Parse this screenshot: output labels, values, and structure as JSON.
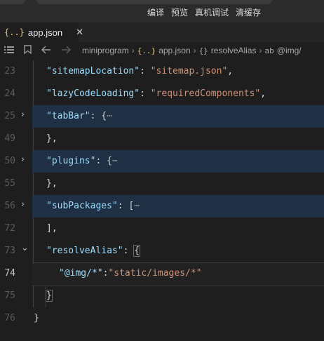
{
  "toolbar": {
    "compile": "编译",
    "preview": "预览",
    "real_device_debug": "真机调试",
    "clear_cache": "清缓存"
  },
  "tab": {
    "file_icon": "{..}",
    "file_name": "app.json",
    "close": "✕"
  },
  "breadcrumb": {
    "items": [
      "miniprogram",
      "app.json",
      "resolveAlias",
      "@img/"
    ]
  },
  "editor": {
    "lines": [
      {
        "n": "23",
        "key": "\"sitemapLocation\"",
        "sep": ": ",
        "val": "\"sitemap.json\"",
        "tail": ","
      },
      {
        "n": "24",
        "key": "\"lazyCodeLoading\"",
        "sep": ": ",
        "val": "\"requiredComponents\"",
        "tail": ","
      },
      {
        "n": "25",
        "key": "\"tabBar\"",
        "sep": ": ",
        "open": "{",
        "ellipsis": "⋯"
      },
      {
        "n": "49",
        "close": "},"
      },
      {
        "n": "50",
        "key": "\"plugins\"",
        "sep": ": ",
        "open": "{",
        "ellipsis": "⋯"
      },
      {
        "n": "55",
        "close": "},"
      },
      {
        "n": "56",
        "key": "\"subPackages\"",
        "sep": ": ",
        "open": "[",
        "ellipsis": "⋯"
      },
      {
        "n": "72",
        "close": "],"
      },
      {
        "n": "73",
        "key": "\"resolveAlias\"",
        "sep": ": ",
        "open": "{"
      },
      {
        "n": "74",
        "key": "\"@img/*\"",
        "sep": ":",
        "val": "\"static/images/*\""
      },
      {
        "n": "75",
        "close": "}"
      },
      {
        "n": "76",
        "close": "}"
      }
    ]
  },
  "colors": {
    "key": "#9cdcfe",
    "string": "#ce9178",
    "punct": "#d4d4d4",
    "folded_bg": "#1f3044",
    "background": "#1e1e1e"
  }
}
